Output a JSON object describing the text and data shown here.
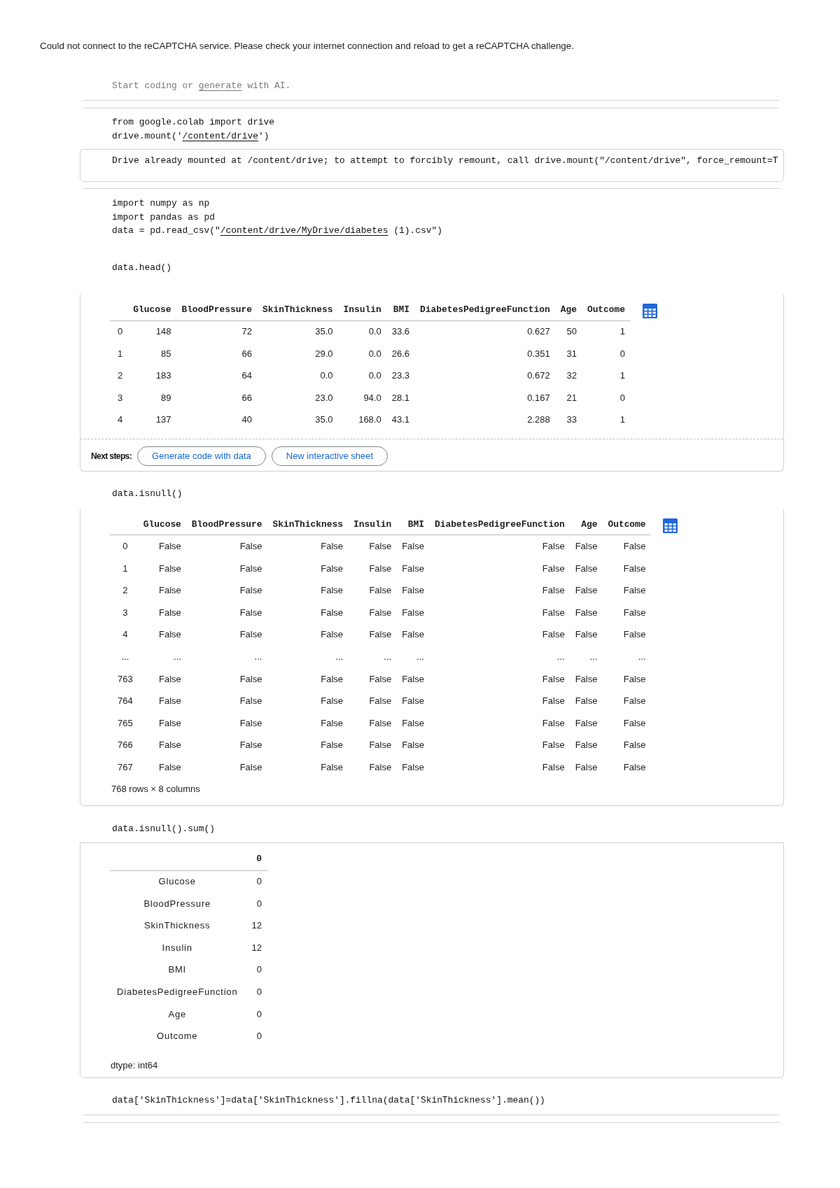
{
  "notice": "Could not connect to the reCAPTCHA service. Please check your internet connection and reload to get a reCAPTCHA challenge.",
  "cells": [
    {
      "kind": "prompt",
      "parts": [
        {
          "kind": "text",
          "text": "Start coding or "
        },
        {
          "kind": "link",
          "text": "generate"
        },
        {
          "kind": "text",
          "text": " with AI."
        }
      ]
    },
    {
      "kind": "code",
      "lines": [
        [
          {
            "kind": "text",
            "text": "from google.colab import drive"
          }
        ],
        [
          {
            "kind": "text",
            "text": "drive.mount('"
          },
          {
            "kind": "link",
            "text": "/content/drive"
          },
          {
            "kind": "text",
            "text": "')"
          }
        ]
      ],
      "output": {
        "kind": "stream",
        "text": "Drive already mounted at /content/drive; to attempt to forcibly remount, call drive.mount(\"/content/drive\", force_remount=T"
      }
    },
    {
      "kind": "code",
      "lines": [
        [
          {
            "kind": "text",
            "text": "import numpy as np"
          }
        ],
        [
          {
            "kind": "text",
            "text": "import pandas as pd"
          }
        ],
        [
          {
            "kind": "text",
            "text": "data = pd.read_csv(\""
          },
          {
            "kind": "link",
            "text": "/content/drive/MyDrive/diabetes"
          },
          {
            "kind": "text",
            "text": " (1).csv\")"
          }
        ]
      ]
    },
    {
      "kind": "code",
      "lines": [
        [
          {
            "kind": "text",
            "text": "data.head()"
          }
        ]
      ],
      "output": {
        "kind": "dataframe",
        "columns": [
          "Glucose",
          "BloodPressure",
          "SkinThickness",
          "Insulin",
          "BMI",
          "DiabetesPedigreeFunction",
          "Age",
          "Outcome"
        ],
        "rows": [
          {
            "index": "0",
            "values": [
              "148",
              "72",
              "35.0",
              "0.0",
              "33.6",
              "0.627",
              "50",
              "1"
            ]
          },
          {
            "index": "1",
            "values": [
              "85",
              "66",
              "29.0",
              "0.0",
              "26.6",
              "0.351",
              "31",
              "0"
            ]
          },
          {
            "index": "2",
            "values": [
              "183",
              "64",
              "0.0",
              "0.0",
              "23.3",
              "0.672",
              "32",
              "1"
            ]
          },
          {
            "index": "3",
            "values": [
              "89",
              "66",
              "23.0",
              "94.0",
              "28.1",
              "0.167",
              "21",
              "0"
            ]
          },
          {
            "index": "4",
            "values": [
              "137",
              "40",
              "35.0",
              "168.0",
              "43.1",
              "2.288",
              "33",
              "1"
            ]
          }
        ],
        "next_steps": {
          "label": "Next steps:",
          "buttons": [
            "Generate code with data",
            "New interactive sheet"
          ]
        }
      }
    },
    {
      "kind": "code",
      "lines": [
        [
          {
            "kind": "text",
            "text": "data.isnull()"
          }
        ]
      ],
      "output": {
        "kind": "dataframe",
        "columns": [
          "Glucose",
          "BloodPressure",
          "SkinThickness",
          "Insulin",
          "BMI",
          "DiabetesPedigreeFunction",
          "Age",
          "Outcome"
        ],
        "rows": [
          {
            "index": "0",
            "values": [
              "False",
              "False",
              "False",
              "False",
              "False",
              "False",
              "False",
              "False"
            ]
          },
          {
            "index": "1",
            "values": [
              "False",
              "False",
              "False",
              "False",
              "False",
              "False",
              "False",
              "False"
            ]
          },
          {
            "index": "2",
            "values": [
              "False",
              "False",
              "False",
              "False",
              "False",
              "False",
              "False",
              "False"
            ]
          },
          {
            "index": "3",
            "values": [
              "False",
              "False",
              "False",
              "False",
              "False",
              "False",
              "False",
              "False"
            ]
          },
          {
            "index": "4",
            "values": [
              "False",
              "False",
              "False",
              "False",
              "False",
              "False",
              "False",
              "False"
            ]
          },
          {
            "index": "...",
            "values": [
              "...",
              "...",
              "...",
              "...",
              "...",
              "...",
              "...",
              "..."
            ]
          },
          {
            "index": "763",
            "values": [
              "False",
              "False",
              "False",
              "False",
              "False",
              "False",
              "False",
              "False"
            ]
          },
          {
            "index": "764",
            "values": [
              "False",
              "False",
              "False",
              "False",
              "False",
              "False",
              "False",
              "False"
            ]
          },
          {
            "index": "765",
            "values": [
              "False",
              "False",
              "False",
              "False",
              "False",
              "False",
              "False",
              "False"
            ]
          },
          {
            "index": "766",
            "values": [
              "False",
              "False",
              "False",
              "False",
              "False",
              "False",
              "False",
              "False"
            ]
          },
          {
            "index": "767",
            "values": [
              "False",
              "False",
              "False",
              "False",
              "False",
              "False",
              "False",
              "False"
            ]
          }
        ],
        "footer": "768 rows × 8 columns"
      }
    },
    {
      "kind": "code",
      "lines": [
        [
          {
            "kind": "text",
            "text": "data.isnull().sum()"
          }
        ]
      ],
      "output": {
        "kind": "series",
        "header": "0",
        "rows": [
          {
            "label": "Glucose",
            "value": "0"
          },
          {
            "label": "BloodPressure",
            "value": "0"
          },
          {
            "label": "SkinThickness",
            "value": "12"
          },
          {
            "label": "Insulin",
            "value": "12"
          },
          {
            "label": "BMI",
            "value": "0"
          },
          {
            "label": "DiabetesPedigreeFunction",
            "value": "0"
          },
          {
            "label": "Age",
            "value": "0"
          },
          {
            "label": "Outcome",
            "value": "0"
          }
        ],
        "dtype": "dtype: int64"
      }
    },
    {
      "kind": "code",
      "lines": [
        [
          {
            "kind": "text",
            "text": "data['SkinThickness']=data['SkinThickness'].fillna(data['SkinThickness'].mean())"
          }
        ]
      ]
    }
  ]
}
